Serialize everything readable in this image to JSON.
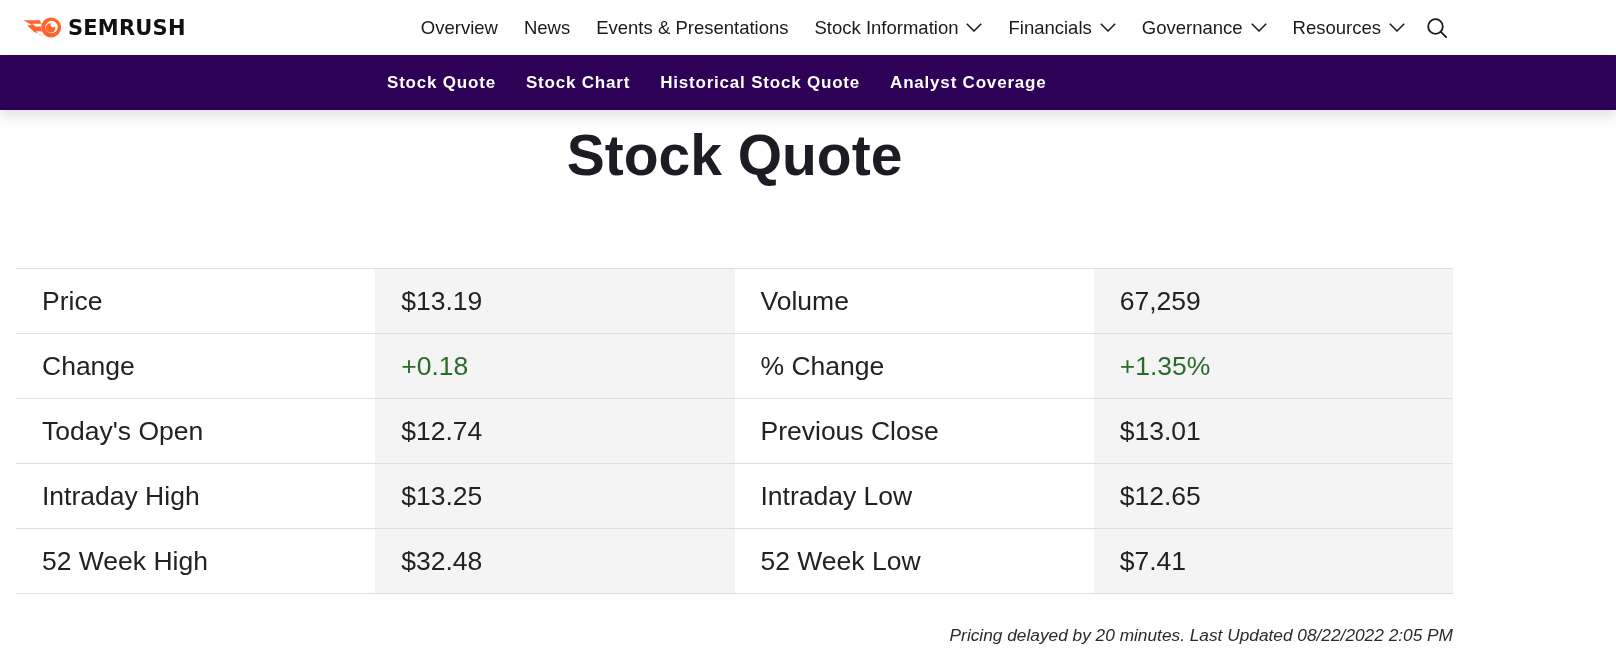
{
  "header": {
    "logo": {
      "text": "SEMRUSH"
    },
    "nav": [
      {
        "label": "Overview",
        "kind": "link"
      },
      {
        "label": "News",
        "kind": "link"
      },
      {
        "label": "Events & Presentations",
        "kind": "link"
      },
      {
        "label": "Stock Information",
        "kind": "menu"
      },
      {
        "label": "Financials",
        "kind": "menu"
      },
      {
        "label": "Governance",
        "kind": "menu"
      },
      {
        "label": "Resources",
        "kind": "menu"
      }
    ]
  },
  "subnav": {
    "items": [
      {
        "label": "Stock Quote"
      },
      {
        "label": "Stock Chart"
      },
      {
        "label": "Historical Stock Quote"
      },
      {
        "label": "Analyst Coverage"
      }
    ]
  },
  "page": {
    "title": "Stock Quote"
  },
  "quote_table": {
    "rows": [
      {
        "pairs": [
          {
            "label": "Price",
            "value": "$13.19"
          },
          {
            "label": "Volume",
            "value": "67,259"
          }
        ]
      },
      {
        "pairs": [
          {
            "label": "Change",
            "value": "+0.18",
            "color": "#2b6a2e"
          },
          {
            "label": "% Change",
            "value": "+1.35%",
            "color": "#2b6a2e"
          }
        ]
      },
      {
        "pairs": [
          {
            "label": "Today's Open",
            "value": "$12.74"
          },
          {
            "label": "Previous Close",
            "value": "$13.01"
          }
        ]
      },
      {
        "pairs": [
          {
            "label": "Intraday High",
            "value": "$13.25"
          },
          {
            "label": "Intraday Low",
            "value": "$12.65"
          }
        ]
      },
      {
        "pairs": [
          {
            "label": "52 Week High",
            "value": "$32.48"
          },
          {
            "label": "52 Week Low",
            "value": "$7.41"
          }
        ]
      }
    ]
  },
  "footnote": "Pricing delayed by 20 minutes. Last Updated 08/22/2022 2:05 PM"
}
